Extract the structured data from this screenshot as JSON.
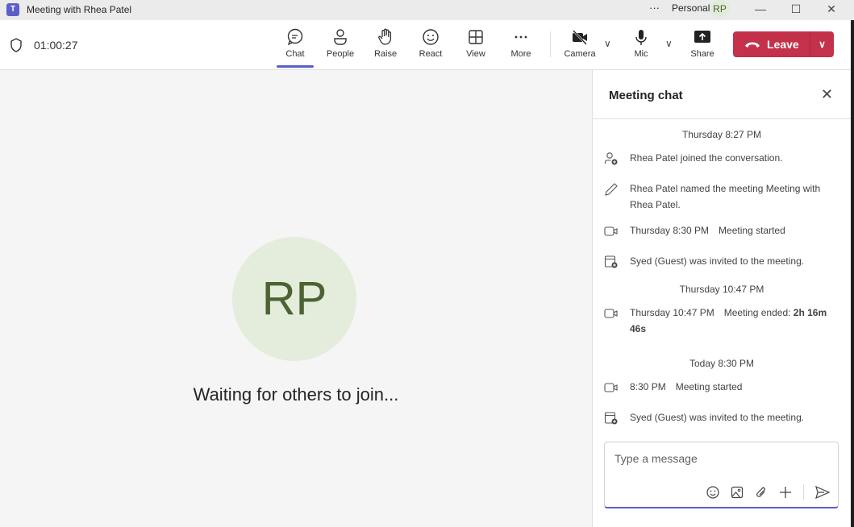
{
  "titlebar": {
    "title": "Meeting with Rhea Patel",
    "more": "···",
    "account": "Personal",
    "avatar": "RP",
    "minimize": "—",
    "maximize": "☐",
    "close": "✕"
  },
  "toolbar": {
    "timer": "01:00:27",
    "chat": "Chat",
    "people": "People",
    "raise": "Raise",
    "react": "React",
    "view": "View",
    "more": "More",
    "camera": "Camera",
    "mic": "Mic",
    "share": "Share",
    "leave": "Leave"
  },
  "stage": {
    "avatar": "RP",
    "status": "Waiting for others to join..."
  },
  "chat": {
    "title": "Meeting chat",
    "groups": [
      {
        "date": "Thursday 8:27 PM",
        "events": [
          {
            "text": "Rhea Patel joined the conversation."
          },
          {
            "text": "Rhea Patel named the meeting Meeting with Rhea Patel."
          },
          {
            "time": "Thursday 8:30 PM",
            "text": "Meeting started"
          },
          {
            "text": "Syed (Guest) was invited to the meeting."
          }
        ]
      },
      {
        "date": "Thursday 10:47 PM",
        "events": [
          {
            "time": "Thursday 10:47 PM",
            "text": "Meeting ended: ",
            "bold": "2h 16m 46s"
          }
        ]
      },
      {
        "date": "Today 8:30 PM",
        "events": [
          {
            "time": "8:30 PM",
            "text": "Meeting started"
          },
          {
            "text": "Syed (Guest) was invited to the meeting."
          }
        ]
      }
    ],
    "placeholder": "Type a message"
  },
  "colors": {
    "accent": "#5b5fc7",
    "leave": "#c4314b",
    "avatar_bg": "#e4ecdb",
    "avatar_fg": "#4b6332"
  }
}
